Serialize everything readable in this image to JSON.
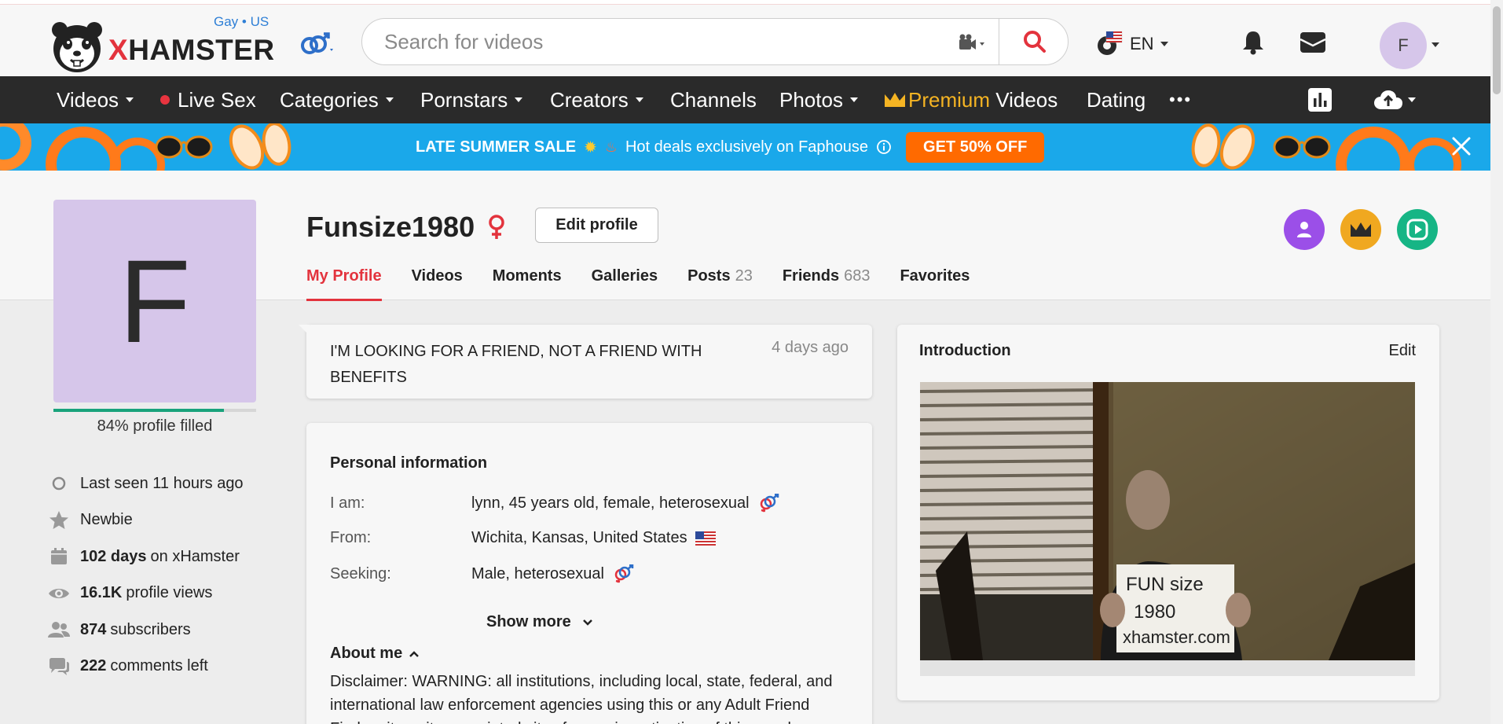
{
  "header": {
    "logo_prefix": "X",
    "logo_rest": "HAMSTER",
    "region": "Gay • US",
    "search_placeholder": "Search for videos",
    "language": "EN",
    "avatar_letter": "F"
  },
  "nav": {
    "videos": "Videos",
    "live_sex": "Live Sex",
    "categories": "Categories",
    "pornstars": "Pornstars",
    "creators": "Creators",
    "channels": "Channels",
    "photos": "Photos",
    "premium_word": "Premium",
    "premium_rest": " Videos",
    "dating": "Dating",
    "more": "•••"
  },
  "banner": {
    "sale": "LATE SUMMER SALE",
    "text": "Hot deals exclusively on Faphouse",
    "cta": "GET 50% OFF"
  },
  "profile": {
    "avatar_letter": "F",
    "progress_fraction": 0.84,
    "filled_text": "84% profile filled",
    "username": "Funsize1980",
    "edit_label": "Edit profile",
    "tabs": {
      "my_profile": "My Profile",
      "videos": "Videos",
      "moments": "Moments",
      "galleries": "Galleries",
      "posts": "Posts",
      "posts_count": "23",
      "friends": "Friends",
      "friends_count": "683",
      "favorites": "Favorites"
    }
  },
  "stats": {
    "last_seen": "Last seen 11 hours ago",
    "level": "Newbie",
    "days_value": "102 days",
    "days_label": "on xHamster",
    "views_value": "16.1K",
    "views_label": "profile views",
    "subs_value": "874",
    "subs_label": "subscribers",
    "comments_value": "222",
    "comments_label": "comments left"
  },
  "status": {
    "text": "I'M LOOKING FOR A FRIEND, NOT A FRIEND WITH BENEFITS",
    "time": "4 days ago"
  },
  "personal": {
    "title": "Personal information",
    "iam_label": "I am:",
    "iam_value": "lynn, 45 years old, female, heterosexual",
    "from_label": "From:",
    "from_value": "Wichita, Kansas, United States",
    "seeking_label": "Seeking:",
    "seeking_value": "Male, heterosexual",
    "show_more": "Show more",
    "about_title": "About me",
    "about_text": "Disclaimer: WARNING: all institutions, including local, state, federal, and international law enforcement agencies using this or any Adult Friend Finder site or its associated sites for any investigation of this member"
  },
  "intro": {
    "title": "Introduction",
    "edit": "Edit",
    "sign_line1": "FUN size",
    "sign_line2": "1980",
    "sign_line3": "xhamster.com"
  },
  "colors": {
    "brand_red": "#e3333d",
    "nav_bg": "#2a2a2a",
    "banner_bg": "#1aa8ea",
    "cta_orange": "#ff6a00",
    "avatar_lilac": "#d6c6ea",
    "progress_green": "#19a37b"
  }
}
